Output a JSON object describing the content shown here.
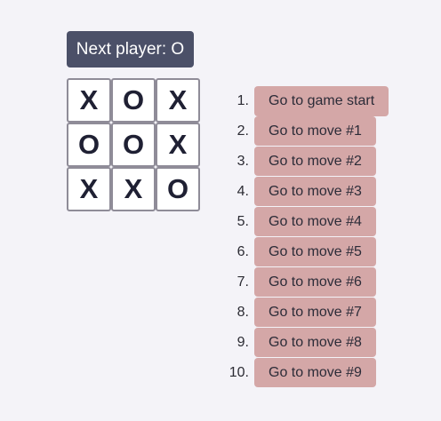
{
  "status": "Next player: O",
  "board": {
    "squares": [
      "X",
      "O",
      "X",
      "O",
      "O",
      "X",
      "X",
      "X",
      "O"
    ]
  },
  "moves": [
    {
      "number": "1.",
      "label": "Go to game start"
    },
    {
      "number": "2.",
      "label": "Go to move #1"
    },
    {
      "number": "3.",
      "label": "Go to move #2"
    },
    {
      "number": "4.",
      "label": "Go to move #3"
    },
    {
      "number": "5.",
      "label": "Go to move #4"
    },
    {
      "number": "6.",
      "label": "Go to move #5"
    },
    {
      "number": "7.",
      "label": "Go to move #6"
    },
    {
      "number": "8.",
      "label": "Go to move #7"
    },
    {
      "number": "9.",
      "label": "Go to move #8"
    },
    {
      "number": "10.",
      "label": "Go to move #9"
    }
  ],
  "colors": {
    "status_bg": "#4b5068",
    "move_button_bg": "#d4a7a7",
    "page_bg": "#f4f3f8",
    "mark": "#1f2033"
  }
}
